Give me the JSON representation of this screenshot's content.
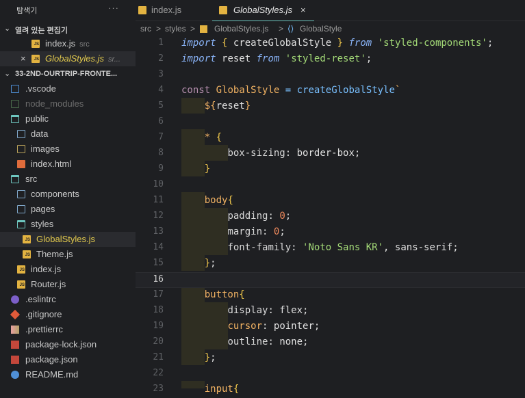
{
  "sidebar": {
    "title": "탐색기",
    "more": "···",
    "open_editors_label": "열려 있는 편집기",
    "open_editors": [
      {
        "name": "index.js",
        "path": "src"
      },
      {
        "name": "GlobalStyles.js",
        "path": "sr..."
      }
    ],
    "project_label": "33-2ND-OURTRIP-FRONTE...",
    "tree": [
      {
        "name": ".vscode"
      },
      {
        "name": "node_modules"
      },
      {
        "name": "public"
      },
      {
        "name": "data"
      },
      {
        "name": "images"
      },
      {
        "name": "index.html"
      },
      {
        "name": "src"
      },
      {
        "name": "components"
      },
      {
        "name": "pages"
      },
      {
        "name": "styles"
      },
      {
        "name": "GlobalStyles.js"
      },
      {
        "name": "Theme.js"
      },
      {
        "name": "index.js"
      },
      {
        "name": "Router.js"
      },
      {
        "name": ".eslintrc"
      },
      {
        "name": ".gitignore"
      },
      {
        "name": ".prettierrc"
      },
      {
        "name": "package-lock.json"
      },
      {
        "name": "package.json"
      },
      {
        "name": "README.md"
      }
    ]
  },
  "tabs": [
    {
      "label": "index.js"
    },
    {
      "label": "GlobalStyles.js",
      "close": "×"
    }
  ],
  "breadcrumb": [
    "src",
    ">",
    "styles",
    ">",
    "GlobalStyles.js",
    ">",
    "GlobalStyle"
  ],
  "editor": {
    "line_numbers": [
      "1",
      "2",
      "3",
      "4",
      "5",
      "6",
      "7",
      "8",
      "9",
      "10",
      "11",
      "12",
      "13",
      "14",
      "15",
      "16",
      "17",
      "18",
      "19",
      "20",
      "21",
      "22",
      "23"
    ]
  },
  "code": {
    "l1": [
      "import",
      "{",
      "createGlobalStyle",
      "}",
      "from",
      "'styled-components'",
      ";"
    ],
    "l2": [
      "import",
      "reset",
      "from",
      "'styled-reset'",
      ";"
    ],
    "l4": [
      "const",
      "GlobalStyle",
      "=",
      "createGlobalStyle",
      "`"
    ],
    "l5": [
      "${",
      "reset",
      "}"
    ],
    "l7": [
      "*",
      "{"
    ],
    "l8": [
      "box-sizing",
      ":",
      "border-box",
      ";"
    ],
    "l9": [
      "}"
    ],
    "l11": [
      "body",
      "{"
    ],
    "l12": [
      "padding",
      ":",
      "0",
      ";"
    ],
    "l13": [
      "margin",
      ":",
      "0",
      ";"
    ],
    "l14": [
      "font-family",
      ":",
      "'Noto Sans KR'",
      ", sans-serif;"
    ],
    "l15": [
      "}",
      ";"
    ],
    "l17": [
      "button",
      "{"
    ],
    "l18": [
      "display",
      ":",
      "flex",
      ";"
    ],
    "l19": [
      "cursor",
      ":",
      "pointer",
      ";"
    ],
    "l20": [
      "outline",
      ":",
      "none",
      ";"
    ],
    "l21": [
      "}",
      ";"
    ],
    "l23": [
      "input",
      "{"
    ]
  }
}
